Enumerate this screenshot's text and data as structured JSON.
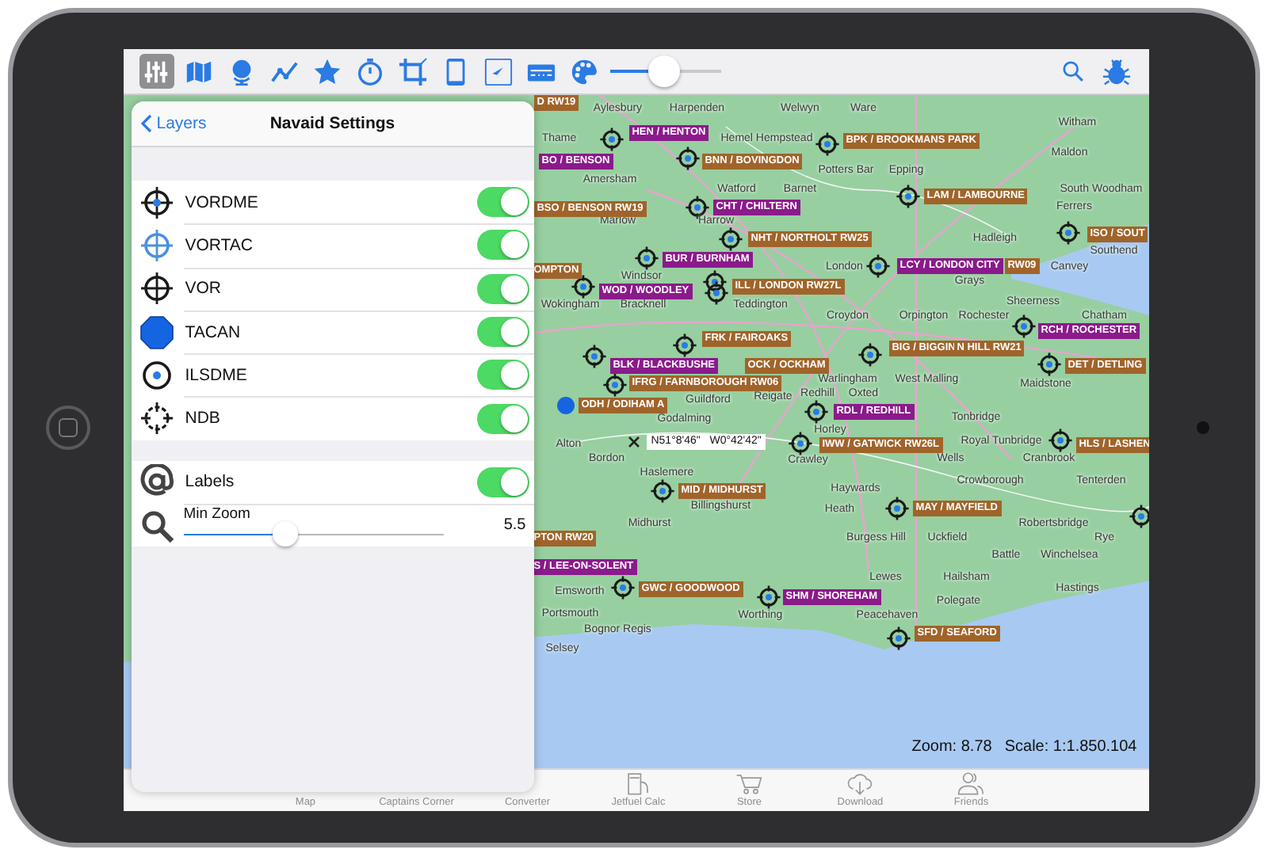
{
  "toolbar": {
    "tools": [
      {
        "selected": true
      },
      {
        "selected": false
      },
      {
        "selected": false
      },
      {
        "selected": false
      },
      {
        "selected": false
      },
      {
        "selected": false
      },
      {
        "selected": false
      },
      {
        "selected": false
      },
      {
        "selected": false
      },
      {
        "selected": false
      },
      {
        "selected": false
      }
    ],
    "slider": {
      "level": 0.49
    }
  },
  "panel": {
    "back_link": "Layers",
    "title": "Navaid Settings",
    "navaids": [
      {
        "kind": "toggle",
        "label": "VORDME",
        "on": true
      },
      {
        "kind": "toggle",
        "label": "VORTAC",
        "on": true
      },
      {
        "kind": "toggle",
        "label": "VOR",
        "on": true
      },
      {
        "kind": "toggle",
        "label": "TACAN",
        "on": true
      },
      {
        "kind": "toggle",
        "label": "ILSDME",
        "on": true
      },
      {
        "kind": "toggle",
        "label": "NDB",
        "on": true
      }
    ],
    "display": [
      {
        "kind": "toggle",
        "label": "Labels",
        "on": true
      },
      {
        "kind": "slider",
        "label": "Min Zoom",
        "level": 0.39,
        "reading": "5.5"
      }
    ]
  },
  "map": {
    "navaid_labels": [
      {
        "text": "D RW19",
        "color": "#a0642a"
      },
      {
        "text": "HEN / HENTON",
        "color": "#8b1a8b"
      },
      {
        "text": "BPK / BROOKMANS PARK",
        "color": "#a0642a"
      },
      {
        "text": "BO / BENSON",
        "color": "#8b1a8b"
      },
      {
        "text": "BNN / BOVINGDON",
        "color": "#a0642a"
      },
      {
        "text": "BSO / BENSON RW19",
        "color": "#a0642a"
      },
      {
        "text": "CHT / CHILTERN",
        "color": "#8b1a8b"
      },
      {
        "text": "LAM / LAMBOURNE",
        "color": "#a0642a"
      },
      {
        "text": "NHT / NORTHOLT RW25",
        "color": "#a0642a"
      },
      {
        "text": "ISO / SOUT",
        "color": "#a0642a"
      },
      {
        "text": "OMPTON",
        "color": "#a0642a"
      },
      {
        "text": "BUR / BURNHAM",
        "color": "#8b1a8b"
      },
      {
        "text": "LCY / LONDON CITY",
        "color": "#8b1a8b"
      },
      {
        "text": "RW09",
        "color": "#a0642a"
      },
      {
        "text": "WOD / WOODLEY",
        "color": "#8b1a8b"
      },
      {
        "text": "ILL / LONDON RW27L",
        "color": "#a0642a"
      },
      {
        "text": "FRK / FAIROAKS",
        "color": "#a0642a"
      },
      {
        "text": "RCH / ROCHESTER",
        "color": "#8b1a8b"
      },
      {
        "text": "BIG / BIGGIN",
        "color": "#a0642a"
      },
      {
        "text": "N HILL RW21",
        "color": "#a0642a"
      },
      {
        "text": "BLK / BLACKBUSHE",
        "color": "#8b1a8b"
      },
      {
        "text": "OCK / OCKHAM",
        "color": "#a0642a"
      },
      {
        "text": "DET / DETLING",
        "color": "#a0642a"
      },
      {
        "text": "IFRG / FARNBOROUGH RW06",
        "color": "#a0642a"
      },
      {
        "text": "ODH / ODIHAM A",
        "color": "#a0642a"
      },
      {
        "text": "RDL / REDHILL",
        "color": "#8b1a8b"
      },
      {
        "text": "IWW / GATWICK RW26L",
        "color": "#a0642a"
      },
      {
        "text": "HLS / LASHEN",
        "color": "#a0642a"
      },
      {
        "text": "MID / MIDHURST",
        "color": "#a0642a"
      },
      {
        "text": "MAY / MAYFIELD",
        "color": "#a0642a"
      },
      {
        "text": "PTON RW20",
        "color": "#a0642a"
      },
      {
        "text": "S / LEE-ON-SOLENT",
        "color": "#8b1a8b"
      },
      {
        "text": "GWC / GOODWOOD",
        "color": "#a0642a"
      },
      {
        "text": "SHM / SHOREHAM",
        "color": "#8b1a8b"
      },
      {
        "text": "SFD / SEAFORD",
        "color": "#a0642a"
      }
    ],
    "place_names": [
      "Aylesbury",
      "Harpenden",
      "Welwyn",
      "Ware",
      "Witham",
      "Thame",
      "Hemel Hempstead",
      "Maldon",
      "Potters Bar",
      "Epping",
      "Amersham",
      "Watford",
      "Barnet",
      "South Woodham",
      "Ferrers",
      "Marlow",
      "Harrow",
      "Hadleigh",
      "Southend",
      "Windsor",
      "London",
      "Canvey",
      "Grays",
      "Wokingham",
      "Bracknell",
      "Teddington",
      "Sheerness",
      "Croydon",
      "Orpington",
      "Rochester",
      "Chatham",
      "Warlingham",
      "West Malling",
      "Maidstone",
      "Guildford",
      "Reigate",
      "Redhill",
      "Oxted",
      "Godalming",
      "Horley",
      "Tonbridge",
      "Alton",
      "Royal Tunbridge",
      "Bordon",
      "Crawley",
      "Wells",
      "Cranbrook",
      "Haslemere",
      "Haywards",
      "Crowborough",
      "Tenterden",
      "Billingshurst",
      "Heath",
      "Midhurst",
      "Robertsbridge",
      "Burgess Hill",
      "Uckfield",
      "Rye",
      "Battle",
      "Winchelsea",
      "Lewes",
      "Hailsham",
      "Emsworth",
      "Hastings",
      "Polegate",
      "Portsmouth",
      "Bognor Regis",
      "Worthing",
      "Peacehaven",
      "Selsey"
    ],
    "coordinates": "N51°8'46\"   W0°42'42\"",
    "zoom": "Zoom: 8.78",
    "scale": "Scale: 1:1.850.104"
  },
  "tab_bar": {
    "items": [
      "Map",
      "Captains Corner",
      "Converter",
      "Jetfuel Calc",
      "Store",
      "Download",
      "Friends"
    ]
  }
}
